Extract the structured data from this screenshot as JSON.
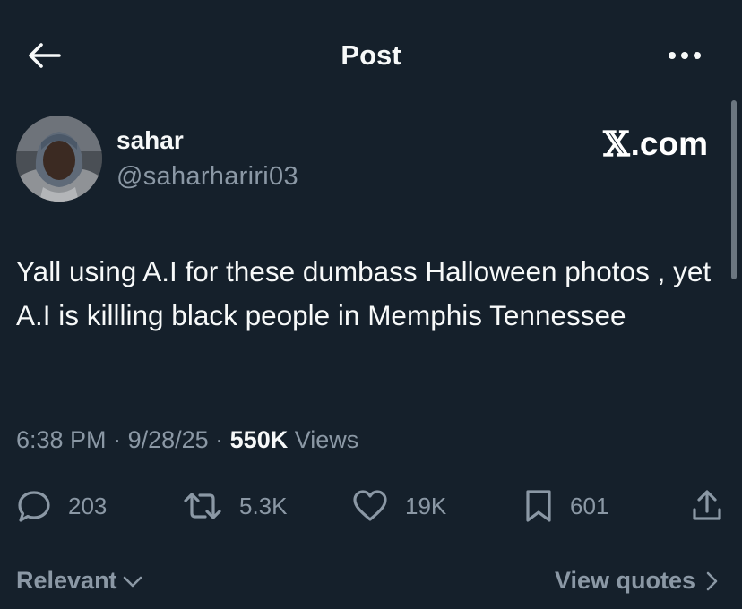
{
  "header": {
    "title": "Post",
    "back_icon": "arrow-left-icon",
    "more_icon": "more-horizontal-icon"
  },
  "author": {
    "name": "sahar",
    "handle": "@saharhariri03",
    "avatar_icon": "avatar-photo"
  },
  "source_badge": {
    "glyph": "𝕏",
    "text": ".com"
  },
  "post": {
    "text": "Yall using A.I for these dumbass Halloween photos , yet A.I is killling black people in Memphis Tennessee"
  },
  "meta": {
    "time": "6:38 PM",
    "sep1": " · ",
    "date": "9/28/25",
    "sep2": " · ",
    "views_count": "550K",
    "views_label": " Views"
  },
  "actions": {
    "replies": {
      "count": "203",
      "icon": "reply-icon"
    },
    "reposts": {
      "count": "5.3K",
      "icon": "repost-icon"
    },
    "likes": {
      "count": "19K",
      "icon": "heart-icon"
    },
    "bookmarks": {
      "count": "601",
      "icon": "bookmark-icon"
    },
    "share": {
      "icon": "share-icon"
    }
  },
  "footer": {
    "sort_label": "Relevant",
    "view_quotes_label": "View quotes"
  },
  "colors": {
    "background": "#15202b",
    "primary_text": "#f7f9f9",
    "secondary_text": "#8b98a5"
  }
}
